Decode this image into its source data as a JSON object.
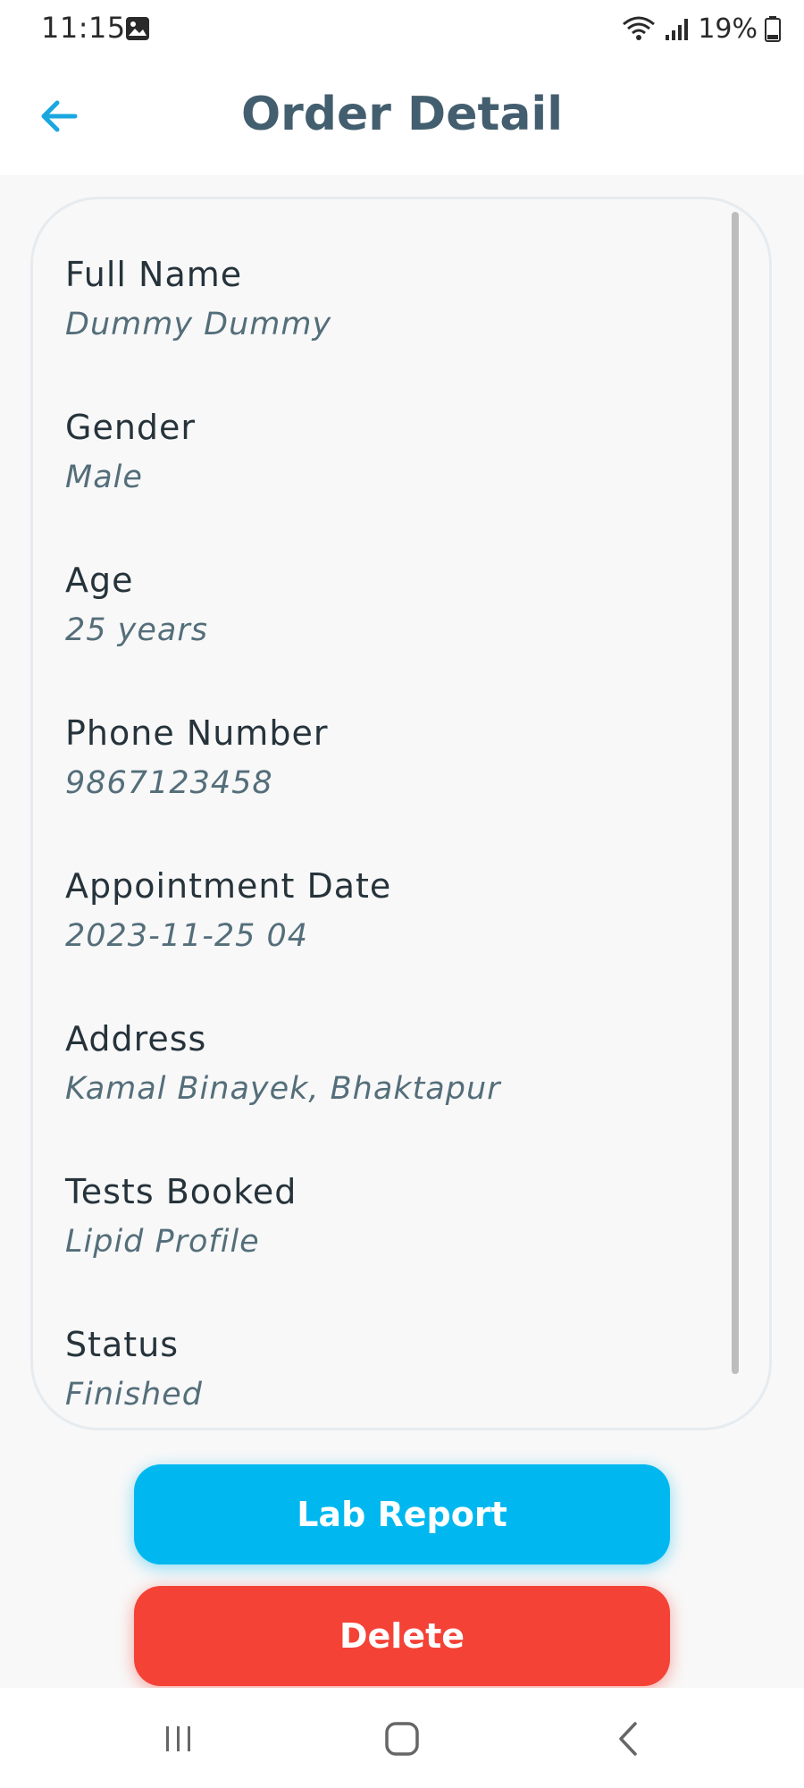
{
  "status_bar": {
    "time": "11:15",
    "battery": "19%",
    "icons": [
      "gallery-icon",
      "wifi-icon",
      "signal-icon",
      "battery-icon"
    ]
  },
  "header": {
    "title": "Order Detail",
    "back_icon": "arrow-left-icon",
    "accent": "#1aa7e0"
  },
  "details": [
    {
      "label": "Full Name",
      "value": "Dummy Dummy"
    },
    {
      "label": "Gender",
      "value": "Male"
    },
    {
      "label": "Age",
      "value": "25 years"
    },
    {
      "label": "Phone Number",
      "value": "9867123458"
    },
    {
      "label": "Appointment Date",
      "value": "2023-11-25 04"
    },
    {
      "label": "Address",
      "value": "Kamal Binayek, Bhaktapur"
    },
    {
      "label": "Tests Booked",
      "value": "Lipid Profile"
    },
    {
      "label": "Status",
      "value": "Finished"
    }
  ],
  "actions": {
    "lab_report": {
      "label": "Lab Report",
      "color": "#00b8ef"
    },
    "delete": {
      "label": "Delete",
      "color": "#f44236"
    }
  },
  "nav": {
    "icons": [
      "recent-apps-icon",
      "home-icon",
      "back-icon"
    ]
  }
}
